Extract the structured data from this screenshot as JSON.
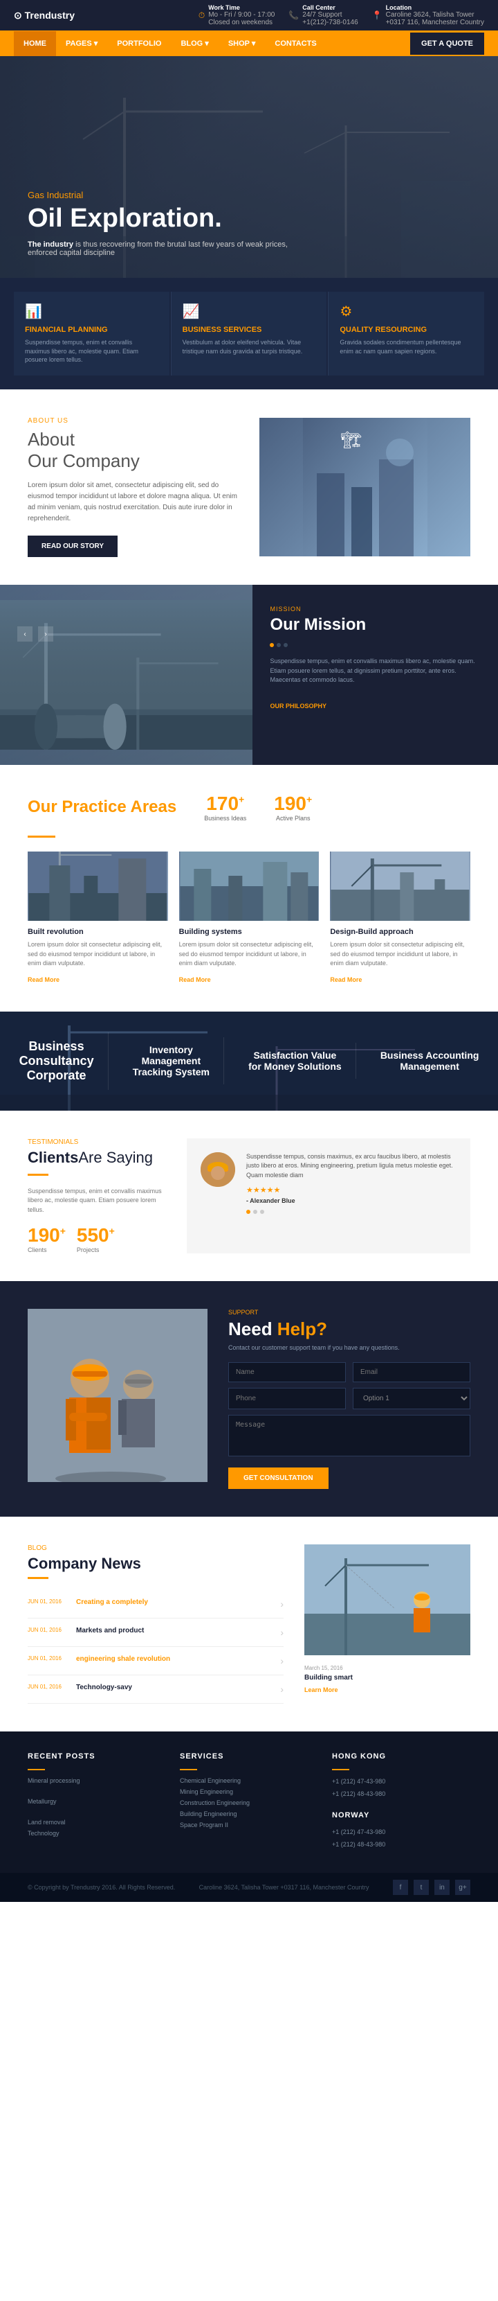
{
  "brand": {
    "name": "Trendustry",
    "logo_icon": "⊙"
  },
  "topbar": {
    "work_time_label": "Work Time",
    "work_time_value": "Mo - Fri / 9:00 - 17:00",
    "work_time_sub": "Closed on weekends",
    "call_center_label": "Call Center",
    "call_center_value": "24/7 Support",
    "call_center_phone": "+1(212)-738-0146",
    "location_label": "Location",
    "location_value": "Caroline 3624, Talisha Tower",
    "location_city": "+0317 116, Manchester Country"
  },
  "nav": {
    "items": [
      "HOME",
      "PAGES ▾",
      "PORTFOLIO",
      "BLOG ▾",
      "SHOP ▾",
      "CONTACTS"
    ],
    "quote_btn": "GET A QUOTE"
  },
  "hero": {
    "subtitle": "Gas Industrial",
    "title": "Oil Exploration.",
    "description": "The industry is thus recovering from the brutal last few years of weak prices, enforced capital discipline",
    "description_bold": "The industry"
  },
  "services": [
    {
      "icon": "📊",
      "title": "Financial Planning",
      "description": "Suspendisse tempus, enim et convallis maximus libero ac, molestie quam. Etiam posuere lorem tellus."
    },
    {
      "icon": "📈",
      "title": "Business Services",
      "description": "Vestibulum at dolor eleifend vehicula. Vitae tristique nam duis gravida at turpis tristique."
    },
    {
      "icon": "⚙",
      "title": "Quality Resourcing",
      "description": "Gravida sodales condimentum pellentesque enim ac nam quam sapien regions."
    }
  ],
  "about": {
    "label": "ABOUT US",
    "heading_line1": "About",
    "heading_line2": "Our Company",
    "description": "Lorem ipsum dolor sit amet, consectetur adipiscing elit, sed do eiusmod tempor incididunt ut labore et dolore magna aliqua. Ut enim ad minim veniam, quis nostrud exercitation. Duis aute irure dolor in reprehenderit.",
    "btn_label": "READ OUR STORY"
  },
  "mission": {
    "label": "MISSION",
    "heading": "Our Mission",
    "description": "Suspendisse tempus, enim et convallis maximus libero ac, molestie quam. Etiam posuere lorem tellus, at dignissim pretium porttitor, ante eros. Maecentas et commodo lacus.",
    "read_more": "OUR PHILOSOPHY"
  },
  "practice": {
    "heading_normal": "Our Practice",
    "heading_orange": " Areas",
    "stat1_num": "170",
    "stat1_sup": "+",
    "stat1_label": "Business Ideas",
    "stat2_num": "190",
    "stat2_sup": "+",
    "stat2_label": "Active Plans",
    "items": [
      {
        "title": "Built revolution",
        "description": "Lorem ipsum dolor sit consectetur adipiscing elit, sed do eiusmod tempor incididunt ut labore, in enim diam vulputate.",
        "read_more": "Read More"
      },
      {
        "title": "Building systems",
        "description": "Lorem ipsum dolor sit consectetur adipiscing elit, sed do eiusmod tempor incididunt ut labore, in enim diam vulputate.",
        "read_more": "Read More"
      },
      {
        "title": "Design-Build approach",
        "description": "Lorem ipsum dolor sit consectetur adipiscing elit, sed do eiusmod tempor incididunt ut labore, in enim diam vulputate.",
        "read_more": "Read More"
      }
    ]
  },
  "banner": {
    "stats": [
      {
        "title": "Business\nConsultancy\nCorporate",
        "description": ""
      },
      {
        "title": "Inventory\nManagement\nTracking System",
        "description": ""
      },
      {
        "title": "Satisfaction Value\nfor Money Solutions",
        "description": ""
      },
      {
        "title": "Business Accounting\nManagement",
        "description": ""
      }
    ]
  },
  "clients": {
    "label": "TESTIMONIALS",
    "heading1": "Clients",
    "heading2": "Are Saying",
    "description": "Suspendisse tempus, enim et convallis maximus libero ac, molestie quam. Etiam posuere lorem tellus.",
    "stat1_num": "190",
    "stat1_sup": "+",
    "stat1_label": "Clients",
    "stat2_num": "550",
    "stat2_sup": "+",
    "stat2_label": "Projects",
    "quote": "Suspendisse tempus, consis maximus, ex arcu faucibus libero, at molestis justo libero at eros. Mining engineering, pretium ligula metus molestie eget. Quam molestie diam",
    "client_name": "- Alexander Blue"
  },
  "support": {
    "label": "SUPPORT",
    "heading1": "Need",
    "heading2": " Help?",
    "description": "Contact our customer support team if you have any questions.",
    "form": {
      "name_placeholder": "Name",
      "email_placeholder": "Email",
      "phone_placeholder": "Phone",
      "option_placeholder": "Option 1",
      "message_placeholder": "Message",
      "btn_label": "GET CONSULTATION"
    }
  },
  "news": {
    "label": "BLOG",
    "heading": "Company News",
    "items": [
      {
        "date": "JUN 01, 2016",
        "title_line1": "Creating a completely",
        "description": "",
        "has_link": true
      },
      {
        "date": "JUN 01, 2016",
        "title_line1": "Markets and product",
        "description": "",
        "has_link": false
      },
      {
        "date": "JUN 01, 2016",
        "title_orange": "engineering shale revolution",
        "title_normal": "",
        "description": ""
      },
      {
        "date": "JUN 01, 2016",
        "title_line1": "Technology-savy",
        "description": "",
        "has_link": false
      }
    ],
    "right_img_date": "March 15, 2016",
    "right_img_title": "Building smart",
    "right_link": "Learn More"
  },
  "footer": {
    "col1": {
      "heading": "Recent Posts",
      "items": [
        "Mineral processing",
        "",
        "Metallurgy",
        "",
        "Land removal",
        "Technology"
      ]
    },
    "col2": {
      "heading": "Services",
      "items": [
        "Chemical Engineering",
        "Mining Engineering",
        "Construction Engineering",
        "Building Engineering",
        "Space Program II"
      ]
    },
    "col3": {
      "heading": "Hong Kong",
      "phone1": "+1 (212) 47-43-980",
      "phone2": "+1 (212) 48-43-980",
      "heading2": "Norway",
      "phone3": "+1 (212) 47-43-980",
      "phone4": "+1 (212) 48-43-980"
    }
  },
  "footer_bottom": {
    "copyright": "© Copyright by Trendustry 2016. All Rights Reserved.",
    "address": "Caroline 3624, Talisha Tower +0317 116, Manchester Country",
    "socials": [
      "f",
      "t",
      "in",
      "g+"
    ]
  }
}
